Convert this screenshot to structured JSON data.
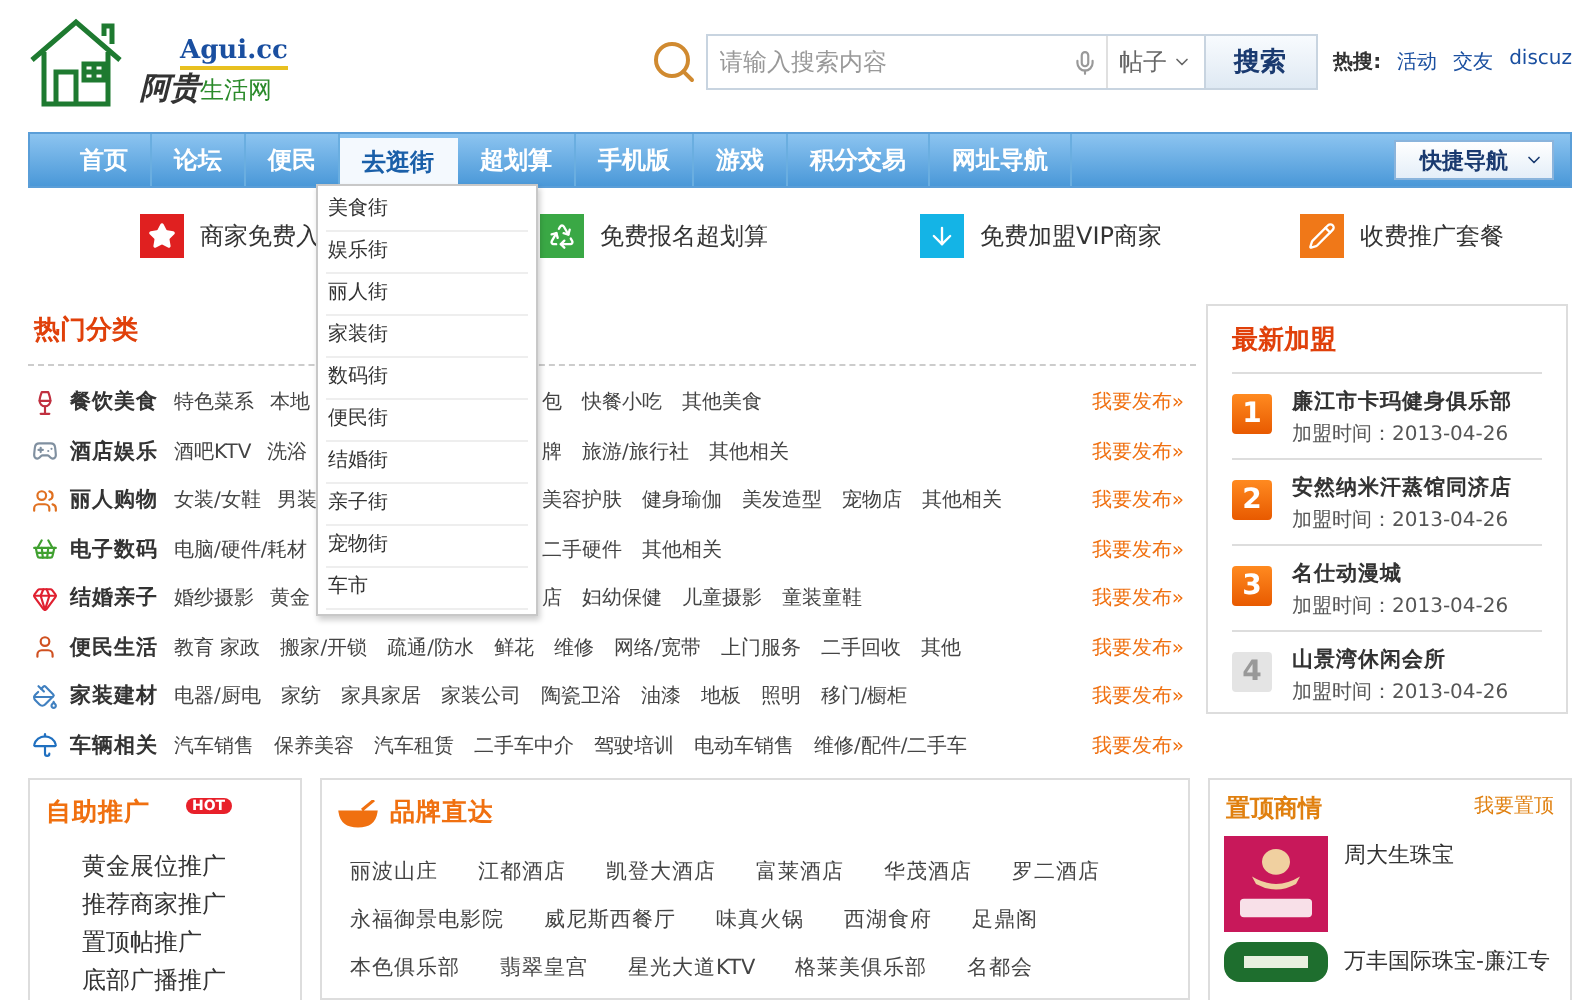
{
  "header": {
    "domain": "Agui.cc",
    "brand_main": "阿贵",
    "brand_sub": "生活网",
    "search": {
      "placeholder": "请输入搜索内容",
      "scope": "帖子",
      "button": "搜索"
    },
    "hot_label": "热搜:",
    "hot_links": [
      "活动",
      "交友",
      "discuz"
    ]
  },
  "nav": {
    "items": [
      {
        "label": "首页",
        "selected": false
      },
      {
        "label": "论坛",
        "selected": false
      },
      {
        "label": "便民",
        "selected": false
      },
      {
        "label": "去逛街",
        "selected": true
      },
      {
        "label": "超划算",
        "selected": false
      },
      {
        "label": "手机版",
        "selected": false
      },
      {
        "label": "游戏",
        "selected": false
      },
      {
        "label": "积分交易",
        "selected": false
      },
      {
        "label": "网址导航",
        "selected": false
      }
    ],
    "quick_nav": "快捷导航",
    "dropdown": [
      "美食街",
      "娱乐街",
      "丽人街",
      "家装街",
      "数码街",
      "便民街",
      "结婚街",
      "亲子街",
      "宠物街",
      "车市"
    ]
  },
  "promos": [
    {
      "label": "商家免费入",
      "color": "#e02020"
    },
    {
      "label": "免费报名超划算",
      "color": "#3aa845"
    },
    {
      "label": "免费加盟VIP商家",
      "color": "#14b4e6"
    },
    {
      "label": "收费推广套餐",
      "color": "#f07818"
    }
  ],
  "categories": {
    "title": "热门分类",
    "rows": [
      {
        "label": "餐饮美食",
        "before": [
          "特色菜系",
          "本地"
        ],
        "after": [
          "包",
          "快餐小吃",
          "其他美食"
        ],
        "action": "我要发布»"
      },
      {
        "label": "酒店娱乐",
        "before": [
          "酒吧KTV",
          "洗浴"
        ],
        "after": [
          "牌",
          "旅游/旅行社",
          "其他相关"
        ],
        "action": "我要发布»"
      },
      {
        "label": "丽人购物",
        "before": [
          "女装/女鞋",
          "男装"
        ],
        "after": [
          "美容护肤",
          "健身瑜伽",
          "美发造型",
          "宠物店",
          "其他相关"
        ],
        "action": "我要发布»"
      },
      {
        "label": "电子数码",
        "before": [
          "电脑/硬件/耗材"
        ],
        "after": [
          "二手硬件",
          "其他相关"
        ],
        "action": "我要发布»"
      },
      {
        "label": "结婚亲子",
        "before": [
          "婚纱摄影",
          "黄金"
        ],
        "after": [
          "店",
          "妇幼保健",
          "儿童摄影",
          "童装童鞋"
        ],
        "action": "我要发布»"
      },
      {
        "label": "便民生活",
        "items": [
          "教育 家政",
          "搬家/开锁",
          "疏通/防水",
          "鲜花",
          "维修",
          "网络/宽带",
          "上门服务",
          "二手回收",
          "其他"
        ],
        "action": "我要发布»"
      },
      {
        "label": "家装建材",
        "items": [
          "电器/厨电",
          "家纺",
          "家具家居",
          "家装公司",
          "陶瓷卫浴",
          "油漆",
          "地板",
          "照明",
          "移门/橱柜"
        ],
        "action": "我要发布»"
      },
      {
        "label": "车辆相关",
        "items": [
          "汽车销售",
          "保养美容",
          "汽车租赁",
          "二手车中介",
          "驾驶培训",
          "电动车销售",
          "维修/配件/二手车"
        ],
        "action": "我要发布»"
      }
    ]
  },
  "newest": {
    "title": "最新加盟",
    "items": [
      {
        "rank": "1",
        "top": true,
        "name": "廉江市卡玛健身俱乐部",
        "date": "加盟时间：2013-04-26"
      },
      {
        "rank": "2",
        "top": true,
        "name": "安然纳米汗蒸馆同济店",
        "date": "加盟时间：2013-04-26"
      },
      {
        "rank": "3",
        "top": true,
        "name": "名仕动漫城",
        "date": "加盟时间：2013-04-26"
      },
      {
        "rank": "4",
        "top": false,
        "name": "山景湾休闲会所",
        "date": "加盟时间：2013-04-26"
      }
    ]
  },
  "self_promo": {
    "title": "自助推广",
    "badge": "HOT",
    "links": [
      "黄金展位推广",
      "推荐商家推广",
      "置顶帖推广",
      "底部广播推广"
    ]
  },
  "brands": {
    "title": "品牌直达",
    "rows": [
      [
        "丽波山庄",
        "江都酒店",
        "凯登大酒店",
        "富莱酒店",
        "华茂酒店",
        "罗二酒店"
      ],
      [
        "永福御景电影院",
        "威尼斯西餐厅",
        "味真火锅",
        "西湖食府",
        "足鼎阁"
      ],
      [
        "本色俱乐部",
        "翡翠皇宫",
        "星光大道KTV",
        "格莱美俱乐部",
        "名都会"
      ]
    ]
  },
  "top_deals": {
    "title": "置顶商情",
    "action": "我要置顶",
    "items": [
      {
        "name": "周大生珠宝",
        "color": "#c8185a"
      },
      {
        "name": "万丰国际珠宝-廉江专",
        "color": "#1e6e2e"
      }
    ]
  }
}
